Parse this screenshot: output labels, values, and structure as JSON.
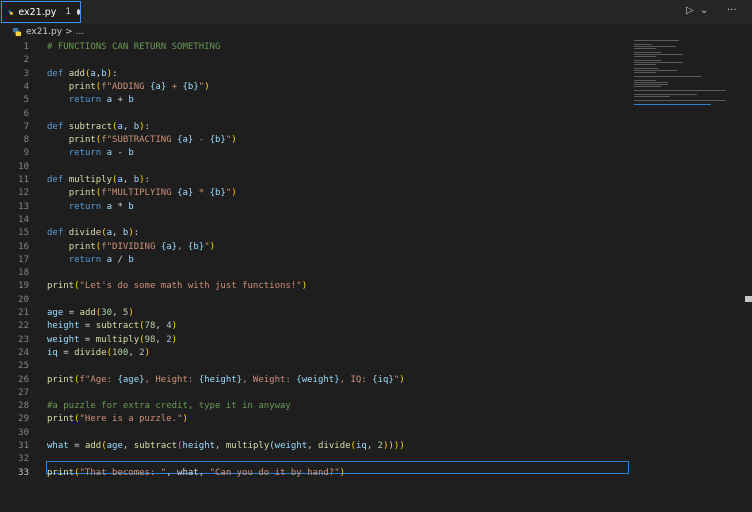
{
  "tab": {
    "label": "ex21.py",
    "number": "1"
  },
  "breadcrumb": {
    "file": "ex21.py",
    "sep": ">",
    "more": "..."
  },
  "toolbar": {
    "run": "▷",
    "run_menu": "⌄",
    "more": "···"
  },
  "colors": {
    "accent": "#3794ff",
    "keyword": "#569cd6",
    "function": "#dcdcaa",
    "string": "#ce9178",
    "comment": "#6a9955",
    "variable": "#9cdcfe",
    "number": "#b5cea8",
    "background": "#1e1e1e"
  },
  "active_line": 33,
  "lines": [
    [
      {
        "t": "# FUNCTIONS CAN RETURN SOMETHING",
        "c": "c"
      }
    ],
    [],
    [
      {
        "t": "def",
        "c": "k"
      },
      {
        "t": " "
      },
      {
        "t": "add",
        "c": "f"
      },
      {
        "t": "(",
        "c": "b"
      },
      {
        "t": "a",
        "c": "v"
      },
      {
        "t": ","
      },
      {
        "t": "b",
        "c": "v"
      },
      {
        "t": ")",
        "c": "b"
      },
      {
        "t": ":"
      }
    ],
    [
      {
        "t": "    "
      },
      {
        "t": "print",
        "c": "f"
      },
      {
        "t": "(",
        "c": "b"
      },
      {
        "t": "f\"ADDING ",
        "c": "s"
      },
      {
        "t": "{a}",
        "c": "v"
      },
      {
        "t": " + ",
        "c": "s"
      },
      {
        "t": "{b}",
        "c": "v"
      },
      {
        "t": "\"",
        "c": "s"
      },
      {
        "t": ")",
        "c": "b"
      }
    ],
    [
      {
        "t": "    "
      },
      {
        "t": "return",
        "c": "k"
      },
      {
        "t": " "
      },
      {
        "t": "a",
        "c": "v"
      },
      {
        "t": " + "
      },
      {
        "t": "b",
        "c": "v"
      }
    ],
    [],
    [
      {
        "t": "def",
        "c": "k"
      },
      {
        "t": " "
      },
      {
        "t": "subtract",
        "c": "f"
      },
      {
        "t": "(",
        "c": "b"
      },
      {
        "t": "a",
        "c": "v"
      },
      {
        "t": ", "
      },
      {
        "t": "b",
        "c": "v"
      },
      {
        "t": ")",
        "c": "b"
      },
      {
        "t": ":"
      }
    ],
    [
      {
        "t": "    "
      },
      {
        "t": "print",
        "c": "f"
      },
      {
        "t": "(",
        "c": "b"
      },
      {
        "t": "f\"SUBTRACTING ",
        "c": "s"
      },
      {
        "t": "{a}",
        "c": "v"
      },
      {
        "t": " - ",
        "c": "s"
      },
      {
        "t": "{b}",
        "c": "v"
      },
      {
        "t": "\"",
        "c": "s"
      },
      {
        "t": ")",
        "c": "b"
      }
    ],
    [
      {
        "t": "    "
      },
      {
        "t": "return",
        "c": "k"
      },
      {
        "t": " "
      },
      {
        "t": "a",
        "c": "v"
      },
      {
        "t": " - "
      },
      {
        "t": "b",
        "c": "v"
      }
    ],
    [],
    [
      {
        "t": "def",
        "c": "k"
      },
      {
        "t": " "
      },
      {
        "t": "multiply",
        "c": "f"
      },
      {
        "t": "(",
        "c": "b"
      },
      {
        "t": "a",
        "c": "v"
      },
      {
        "t": ", "
      },
      {
        "t": "b",
        "c": "v"
      },
      {
        "t": ")",
        "c": "b"
      },
      {
        "t": ":"
      }
    ],
    [
      {
        "t": "    "
      },
      {
        "t": "print",
        "c": "f"
      },
      {
        "t": "(",
        "c": "b"
      },
      {
        "t": "f\"MULTIPLYING ",
        "c": "s"
      },
      {
        "t": "{a}",
        "c": "v"
      },
      {
        "t": " * ",
        "c": "s"
      },
      {
        "t": "{b}",
        "c": "v"
      },
      {
        "t": "\"",
        "c": "s"
      },
      {
        "t": ")",
        "c": "b"
      }
    ],
    [
      {
        "t": "    "
      },
      {
        "t": "return",
        "c": "k"
      },
      {
        "t": " "
      },
      {
        "t": "a",
        "c": "v"
      },
      {
        "t": " * "
      },
      {
        "t": "b",
        "c": "v"
      }
    ],
    [],
    [
      {
        "t": "def",
        "c": "k"
      },
      {
        "t": " "
      },
      {
        "t": "divide",
        "c": "f"
      },
      {
        "t": "(",
        "c": "b"
      },
      {
        "t": "a",
        "c": "v"
      },
      {
        "t": ", "
      },
      {
        "t": "b",
        "c": "v"
      },
      {
        "t": ")",
        "c": "b"
      },
      {
        "t": ":"
      }
    ],
    [
      {
        "t": "    "
      },
      {
        "t": "print",
        "c": "f"
      },
      {
        "t": "(",
        "c": "b"
      },
      {
        "t": "f\"DIVIDING ",
        "c": "s"
      },
      {
        "t": "{a}",
        "c": "v"
      },
      {
        "t": ", ",
        "c": "s"
      },
      {
        "t": "{b}",
        "c": "v"
      },
      {
        "t": "\"",
        "c": "s"
      },
      {
        "t": ")",
        "c": "b"
      }
    ],
    [
      {
        "t": "    "
      },
      {
        "t": "return",
        "c": "k"
      },
      {
        "t": " "
      },
      {
        "t": "a",
        "c": "v"
      },
      {
        "t": " / "
      },
      {
        "t": "b",
        "c": "v"
      }
    ],
    [],
    [
      {
        "t": "print",
        "c": "f"
      },
      {
        "t": "(",
        "c": "b"
      },
      {
        "t": "\"Let's do some math with just functions!\"",
        "c": "s"
      },
      {
        "t": ")",
        "c": "b"
      }
    ],
    [],
    [
      {
        "t": "age",
        "c": "v"
      },
      {
        "t": " = "
      },
      {
        "t": "add",
        "c": "f"
      },
      {
        "t": "(",
        "c": "b"
      },
      {
        "t": "30",
        "c": "n"
      },
      {
        "t": ", "
      },
      {
        "t": "5",
        "c": "n"
      },
      {
        "t": ")",
        "c": "b"
      }
    ],
    [
      {
        "t": "height",
        "c": "v"
      },
      {
        "t": " = "
      },
      {
        "t": "subtract",
        "c": "f"
      },
      {
        "t": "(",
        "c": "b"
      },
      {
        "t": "78",
        "c": "n"
      },
      {
        "t": ", "
      },
      {
        "t": "4",
        "c": "n"
      },
      {
        "t": ")",
        "c": "b"
      }
    ],
    [
      {
        "t": "weight",
        "c": "v"
      },
      {
        "t": " = "
      },
      {
        "t": "multiply",
        "c": "f"
      },
      {
        "t": "(",
        "c": "b"
      },
      {
        "t": "98",
        "c": "n"
      },
      {
        "t": ", "
      },
      {
        "t": "2",
        "c": "n"
      },
      {
        "t": ")",
        "c": "b"
      }
    ],
    [
      {
        "t": "iq",
        "c": "v"
      },
      {
        "t": " = "
      },
      {
        "t": "divide",
        "c": "f"
      },
      {
        "t": "(",
        "c": "b"
      },
      {
        "t": "100",
        "c": "n"
      },
      {
        "t": ", "
      },
      {
        "t": "2",
        "c": "n"
      },
      {
        "t": ")",
        "c": "b"
      }
    ],
    [],
    [
      {
        "t": "print",
        "c": "f"
      },
      {
        "t": "(",
        "c": "b"
      },
      {
        "t": "f\"Age: ",
        "c": "s"
      },
      {
        "t": "{age}",
        "c": "v"
      },
      {
        "t": ", Height: ",
        "c": "s"
      },
      {
        "t": "{height}",
        "c": "v"
      },
      {
        "t": ", Weight: ",
        "c": "s"
      },
      {
        "t": "{weight}",
        "c": "v"
      },
      {
        "t": ", IQ: ",
        "c": "s"
      },
      {
        "t": "{iq}",
        "c": "v"
      },
      {
        "t": "\"",
        "c": "s"
      },
      {
        "t": ")",
        "c": "b"
      }
    ],
    [],
    [
      {
        "t": "#a puzzle for extra credit, type it in anyway",
        "c": "c"
      }
    ],
    [
      {
        "t": "print",
        "c": "f"
      },
      {
        "t": "(",
        "c": "b"
      },
      {
        "t": "\"Here is a puzzle.\"",
        "c": "s"
      },
      {
        "t": ")",
        "c": "b"
      }
    ],
    [],
    [
      {
        "t": "what",
        "c": "v"
      },
      {
        "t": " = "
      },
      {
        "t": "add",
        "c": "f"
      },
      {
        "t": "(",
        "c": "b"
      },
      {
        "t": "age",
        "c": "v"
      },
      {
        "t": ", "
      },
      {
        "t": "subtract",
        "c": "f"
      },
      {
        "t": "(",
        "c": "p"
      },
      {
        "t": "height",
        "c": "v"
      },
      {
        "t": ", "
      },
      {
        "t": "multiply",
        "c": "f"
      },
      {
        "t": "(",
        "c": "v"
      },
      {
        "t": "weight",
        "c": "v"
      },
      {
        "t": ", "
      },
      {
        "t": "divide",
        "c": "f"
      },
      {
        "t": "(",
        "c": "b"
      },
      {
        "t": "iq",
        "c": "v"
      },
      {
        "t": ", "
      },
      {
        "t": "2",
        "c": "n"
      },
      {
        "t": ")))",
        "c": "b"
      },
      {
        "t": ")",
        "c": "b"
      }
    ],
    [],
    [
      {
        "t": "print",
        "c": "f"
      },
      {
        "t": "(",
        "c": "b"
      },
      {
        "t": "\"That becomes: \"",
        "c": "s"
      },
      {
        "t": ", what, "
      },
      {
        "t": "\"Can you do it by hand?\"",
        "c": "s"
      },
      {
        "t": ")",
        "c": "b"
      }
    ]
  ]
}
